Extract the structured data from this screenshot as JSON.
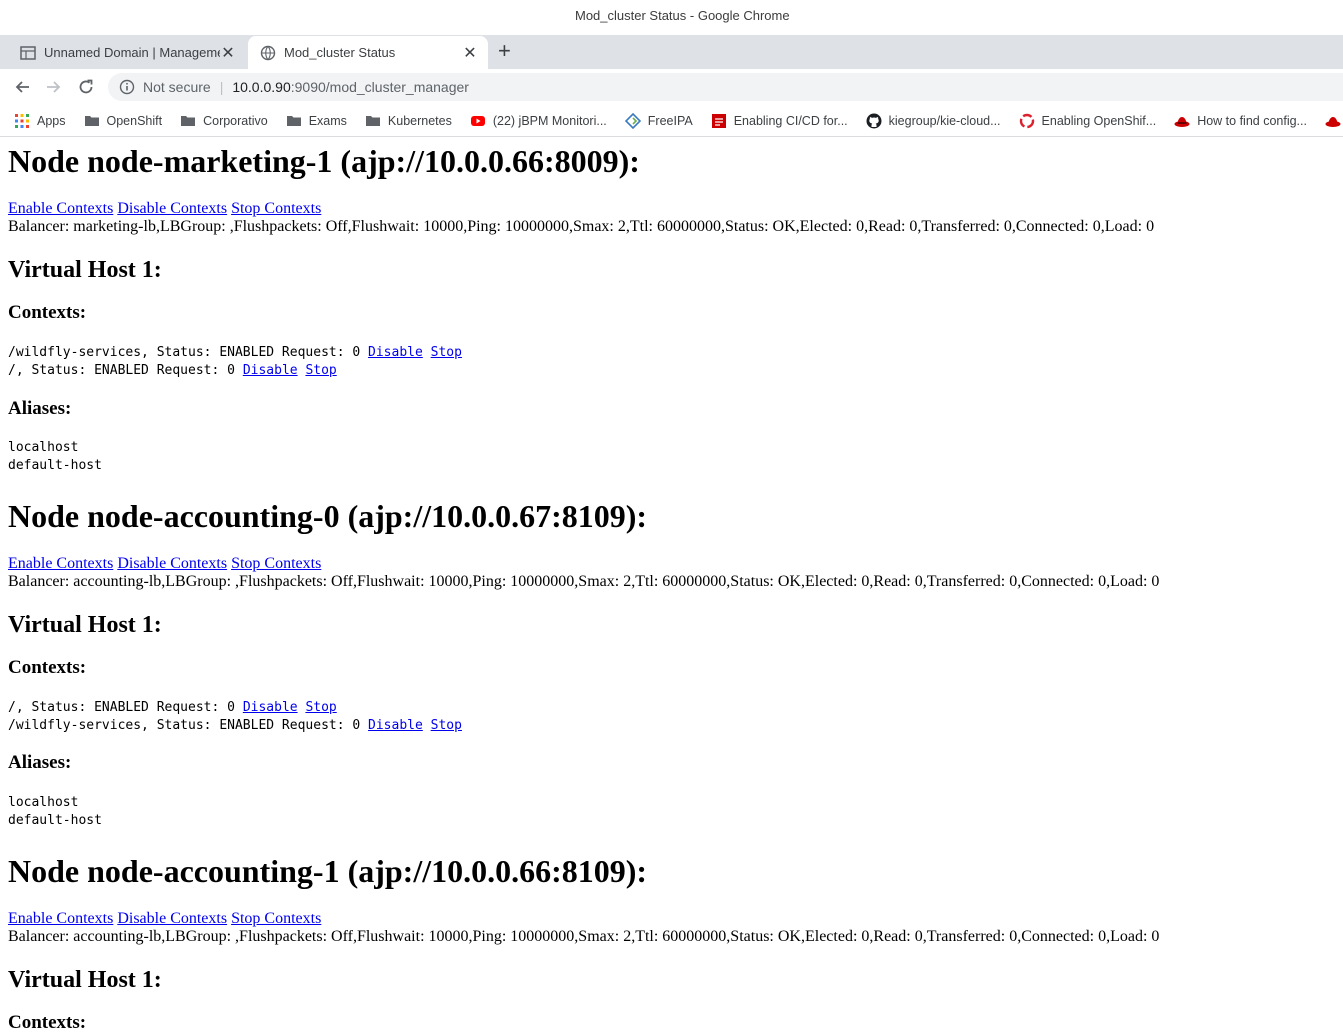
{
  "window": {
    "title": "Mod_cluster Status - Google Chrome"
  },
  "tabs": [
    {
      "label": "Unnamed Domain | Manageme",
      "close": "✕"
    },
    {
      "label": "Mod_cluster Status",
      "close": "✕"
    }
  ],
  "newtab": "+",
  "toolbar": {
    "security": "Not secure",
    "url_host": "10.0.0.90",
    "url_path": ":9090/mod_cluster_manager"
  },
  "bookmarks": [
    {
      "label": "Apps",
      "icon": "apps-grid-icon"
    },
    {
      "label": "OpenShift",
      "icon": "folder-icon"
    },
    {
      "label": "Corporativo",
      "icon": "folder-icon"
    },
    {
      "label": "Exams",
      "icon": "folder-icon"
    },
    {
      "label": "Kubernetes",
      "icon": "folder-icon"
    },
    {
      "label": "(22) jBPM Monitori...",
      "icon": "youtube-icon"
    },
    {
      "label": "FreeIPA",
      "icon": "freeipa-icon"
    },
    {
      "label": "Enabling CI/CD for...",
      "icon": "redhat-icon"
    },
    {
      "label": "kiegroup/kie-cloud...",
      "icon": "github-icon"
    },
    {
      "label": "Enabling OpenShif...",
      "icon": "openshift-icon"
    },
    {
      "label": "How to find config...",
      "icon": "redhat-hat-icon"
    }
  ],
  "page": {
    "common": {
      "enable": "Enable Contexts",
      "disable": "Disable Contexts",
      "stop": "Stop Contexts",
      "vhost": "Virtual Host 1:",
      "contexts": "Contexts:",
      "aliases": "Aliases:",
      "ctx_disable": "Disable",
      "ctx_stop": "Stop",
      "alias1": "localhost",
      "alias2": "default-host"
    },
    "nodes": [
      {
        "title": "Node node-marketing-1 (ajp://10.0.0.66:8009):",
        "balancer": "Balancer: marketing-lb,LBGroup: ,Flushpackets: Off,Flushwait: 10000,Ping: 10000000,Smax: 2,Ttl: 60000000,Status: OK,Elected: 0,Read: 0,Transferred: 0,Connected: 0,Load: 0",
        "ctx1": "/wildfly-services, Status: ENABLED Request: 0 ",
        "ctx2": "/, Status: ENABLED Request: 0 "
      },
      {
        "title": "Node node-accounting-0 (ajp://10.0.0.67:8109):",
        "balancer": "Balancer: accounting-lb,LBGroup: ,Flushpackets: Off,Flushwait: 10000,Ping: 10000000,Smax: 2,Ttl: 60000000,Status: OK,Elected: 0,Read: 0,Transferred: 0,Connected: 0,Load: 0",
        "ctx1": "/, Status: ENABLED Request: 0 ",
        "ctx2": "/wildfly-services, Status: ENABLED Request: 0 "
      },
      {
        "title": "Node node-accounting-1 (ajp://10.0.0.66:8109):",
        "balancer": "Balancer: accounting-lb,LBGroup: ,Flushpackets: Off,Flushwait: 10000,Ping: 10000000,Smax: 2,Ttl: 60000000,Status: OK,Elected: 0,Read: 0,Transferred: 0,Connected: 0,Load: 0"
      }
    ]
  }
}
